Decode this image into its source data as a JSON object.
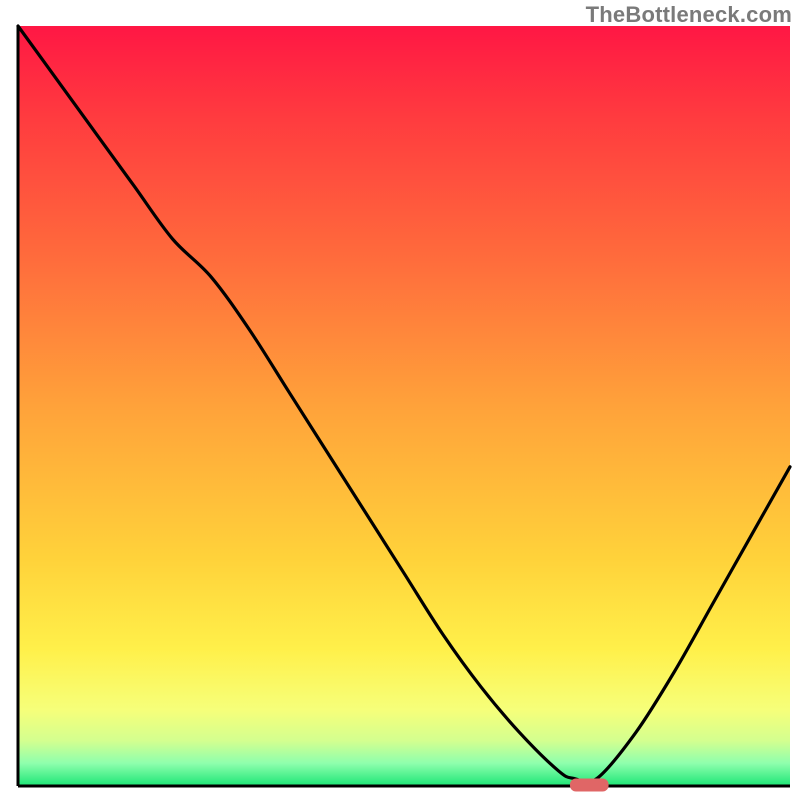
{
  "watermark": "TheBottleneck.com",
  "chart_data": {
    "type": "line",
    "title": "",
    "xlabel": "",
    "ylabel": "",
    "xlim": [
      0,
      100
    ],
    "ylim": [
      0,
      100
    ],
    "grid": false,
    "legend": false,
    "series": [
      {
        "name": "bottleneck-curve",
        "color": "#000000",
        "x": [
          0,
          5,
          10,
          15,
          20,
          25,
          30,
          35,
          40,
          45,
          50,
          55,
          60,
          65,
          70,
          72,
          75,
          80,
          85,
          90,
          95,
          100
        ],
        "y": [
          100,
          93,
          86,
          79,
          72,
          67,
          60,
          52,
          44,
          36,
          28,
          20,
          13,
          7,
          2,
          1,
          1,
          7,
          15,
          24,
          33,
          42
        ]
      }
    ],
    "marker": {
      "name": "optimal-point",
      "x_center": 74,
      "width_pct": 5,
      "color": "#e06666"
    },
    "gradient_stops": [
      {
        "offset": 0.0,
        "color": "#ff1744"
      },
      {
        "offset": 0.12,
        "color": "#ff3b3f"
      },
      {
        "offset": 0.3,
        "color": "#ff6a3c"
      },
      {
        "offset": 0.5,
        "color": "#ffa23a"
      },
      {
        "offset": 0.7,
        "color": "#ffd23a"
      },
      {
        "offset": 0.82,
        "color": "#fff04a"
      },
      {
        "offset": 0.9,
        "color": "#f6ff7a"
      },
      {
        "offset": 0.94,
        "color": "#d4ff8f"
      },
      {
        "offset": 0.97,
        "color": "#8fffad"
      },
      {
        "offset": 1.0,
        "color": "#1de676"
      }
    ]
  }
}
